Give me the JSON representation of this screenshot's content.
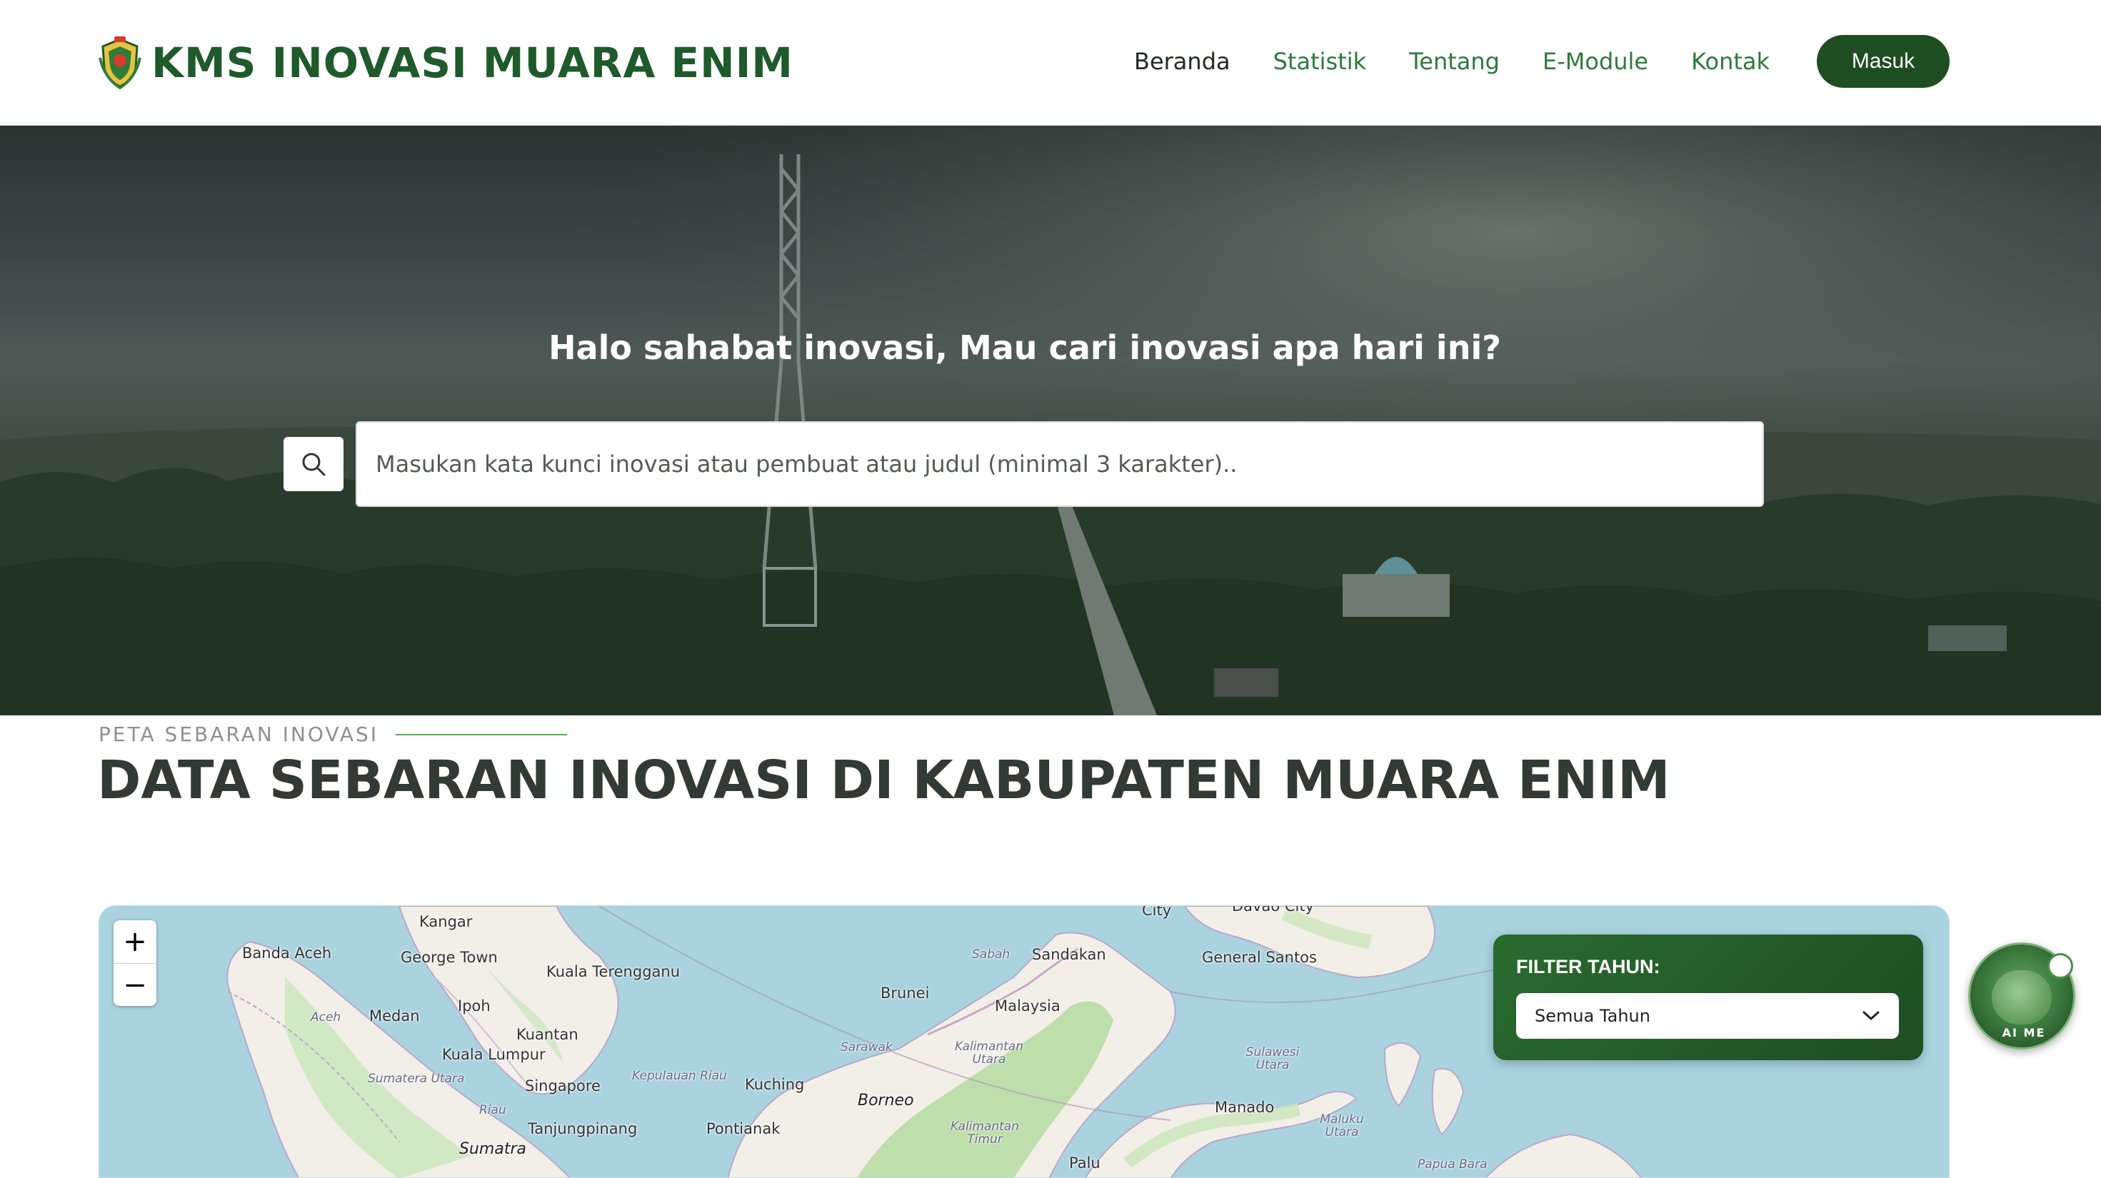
{
  "brand": {
    "name": "KMS INOVASI MUARA ENIM",
    "logo_icon": "muara-enim-crest-icon"
  },
  "nav": {
    "items": [
      {
        "label": "Beranda",
        "active": true
      },
      {
        "label": "Statistik",
        "active": false
      },
      {
        "label": "Tentang",
        "active": false
      },
      {
        "label": "E-Module",
        "active": false
      },
      {
        "label": "Kontak",
        "active": false
      }
    ],
    "login_label": "Masuk"
  },
  "hero": {
    "title": "Halo sahabat inovasi, Mau cari inovasi apa hari ini?",
    "search_placeholder": "Masukan kata kunci inovasi atau pembuat atau judul (minimal 3 karakter)..",
    "search_icon": "search-icon"
  },
  "section": {
    "kicker": "PETA SEBARAN INOVASI",
    "title": "DATA SEBARAN INOVASI DI KABUPATEN MUARA ENIM"
  },
  "map": {
    "zoom_in": "+",
    "zoom_out": "−",
    "labels": {
      "kangar": "Kangar",
      "banda_aceh": "Banda Aceh",
      "george_town": "George Town",
      "kuala_terengganu": "Kuala Terengganu",
      "ipoh": "Ipoh",
      "medan": "Medan",
      "aceh": "Aceh",
      "kuantan": "Kuantan",
      "kuala_lumpur": "Kuala Lumpur",
      "sumatera_utara": "Sumatera Utara",
      "singapore": "Singapore",
      "riau": "Riau",
      "kepulauan_riau": "Kepulauan Riau",
      "tanjungpinang": "Tanjungpinang",
      "sumatra": "Sumatra",
      "sabah": "Sabah",
      "sandakan": "Sandakan",
      "brunei": "Brunei",
      "malaysia": "Malaysia",
      "sarawak": "Sarawak",
      "kalimantan_utara": "Kalimantan Utara",
      "kuching": "Kuching",
      "borneo": "Borneo",
      "pontianak": "Pontianak",
      "kalimantan_timur": "Kalimantan Timur",
      "city": "City",
      "davao_city": "Davao City",
      "general_santos": "General Santos",
      "sulawesi_utara": "Sulawesi Utara",
      "manado": "Manado",
      "maluku_utara": "Maluku Utara",
      "palu": "Palu",
      "papua_barat": "Papua Bara"
    },
    "filter": {
      "label": "FILTER TAHUN:",
      "selected": "Semua Tahun",
      "chevron_icon": "chevron-down-icon"
    }
  },
  "ai_me": {
    "label": "AI ME"
  }
}
